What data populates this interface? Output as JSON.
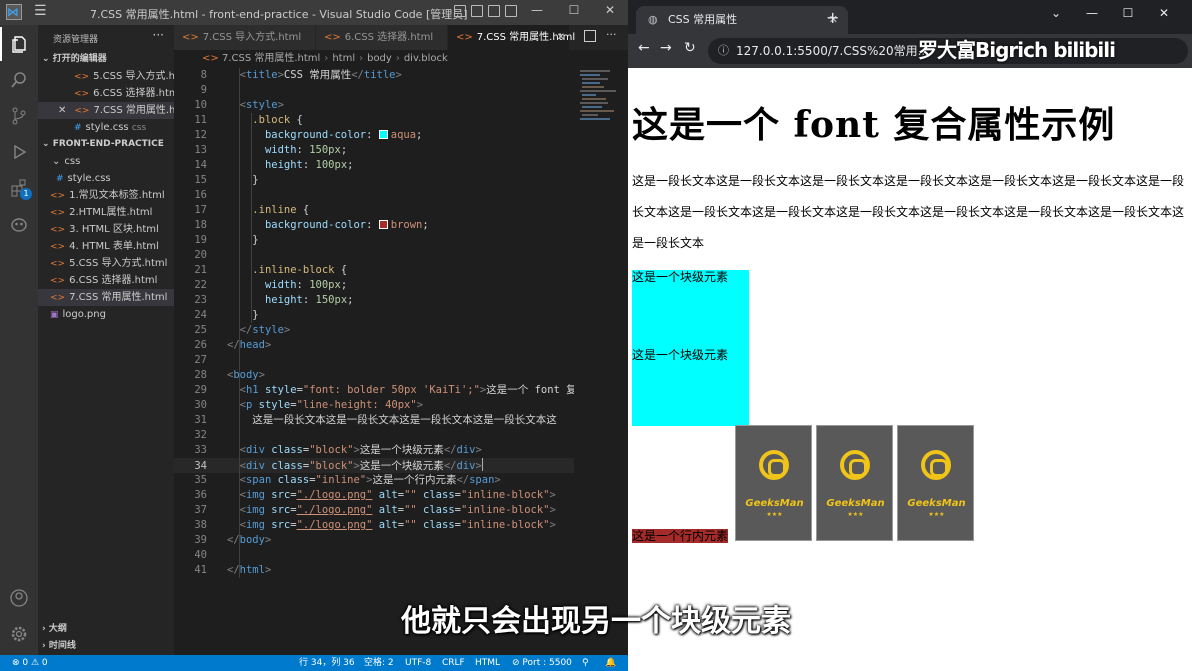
{
  "vscode": {
    "window_title": "7.CSS 常用属性.html - front-end-practice - Visual Studio Code [管理员]",
    "explorer_title": "资源管理器",
    "open_editors_label": "打开的编辑器",
    "open_editors": [
      {
        "name": "5.CSS 导入方式.h...",
        "icon": "html-icon"
      },
      {
        "name": "6.CSS 选择器.html",
        "icon": "html-icon"
      },
      {
        "name": "7.CSS 常用属性.h...",
        "icon": "html-icon",
        "active": true
      },
      {
        "name": "style.css",
        "detail": "css",
        "icon": "css-icon"
      }
    ],
    "project_label": "FRONT-END-PRACTICE",
    "tree": [
      {
        "name": "css",
        "type": "folder"
      },
      {
        "name": "style.css",
        "type": "css"
      },
      {
        "name": "1.常见文本标签.html",
        "type": "html"
      },
      {
        "name": "2.HTML属性.html",
        "type": "html"
      },
      {
        "name": "3. HTML 区块.html",
        "type": "html"
      },
      {
        "name": "4. HTML 表单.html",
        "type": "html"
      },
      {
        "name": "5.CSS 导入方式.html",
        "type": "html"
      },
      {
        "name": "6.CSS 选择器.html",
        "type": "html"
      },
      {
        "name": "7.CSS 常用属性.html",
        "type": "html",
        "selected": true
      },
      {
        "name": "logo.png",
        "type": "image"
      }
    ],
    "outline_label": "大纲",
    "timeline_label": "时间线",
    "tabs": [
      {
        "label": "7.CSS 导入方式.html"
      },
      {
        "label": "6.CSS 选择器.html"
      },
      {
        "label": "7.CSS 常用属性.html",
        "active": true
      }
    ],
    "breadcrumb": [
      "7.CSS 常用属性.html",
      "html",
      "body",
      "div.block"
    ],
    "code": {
      "l8": {
        "n": "8",
        "a": "<",
        "b": "title",
        "c": ">",
        "d": "CSS 常用属性",
        "e": "</",
        "f": "title",
        "g": ">"
      },
      "l10": {
        "n": "10",
        "a": "<",
        "b": "style",
        "c": ">"
      },
      "l11": {
        "n": "11",
        "a": ".block",
        "b": " {"
      },
      "l12": {
        "n": "12",
        "a": "background-color",
        "b": ": ",
        "c": "aqua",
        "d": ";"
      },
      "l13": {
        "n": "13",
        "a": "width",
        "b": ": ",
        "c": "150px",
        "d": ";"
      },
      "l14": {
        "n": "14",
        "a": "height",
        "b": ": ",
        "c": "100px",
        "d": ";"
      },
      "l15": {
        "n": "15",
        "a": "}"
      },
      "l17": {
        "n": "17",
        "a": ".inline",
        "b": " {"
      },
      "l18": {
        "n": "18",
        "a": "background-color",
        "b": ": ",
        "c": "brown",
        "d": ";"
      },
      "l19": {
        "n": "19",
        "a": "}"
      },
      "l21": {
        "n": "21",
        "a": ".inline-block",
        "b": " {"
      },
      "l22": {
        "n": "22",
        "a": "width",
        "b": ": ",
        "c": "100px",
        "d": ";"
      },
      "l23": {
        "n": "23",
        "a": "height",
        "b": ": ",
        "c": "150px",
        "d": ";"
      },
      "l24": {
        "n": "24",
        "a": "}"
      },
      "l25": {
        "n": "25",
        "a": "</",
        "b": "style",
        "c": ">"
      },
      "l26": {
        "n": "26",
        "a": "</",
        "b": "head",
        "c": ">"
      },
      "l28": {
        "n": "28",
        "a": "<",
        "b": "body",
        "c": ">"
      },
      "l29": {
        "n": "29",
        "a": "<",
        "b": "h1",
        "c": " style",
        "d": "=",
        "e": "\"font: bolder 50px 'KaiTi';\"",
        "f": ">",
        "g": "这是一个 font 复合"
      },
      "l30": {
        "n": "30",
        "a": "<",
        "b": "p",
        "c": " style",
        "d": "=",
        "e": "\"line-height: 40px\"",
        "f": ">"
      },
      "l31": {
        "n": "31",
        "a": "这是一段长文本这是一段长文本这是一段长文本这是一段长文本这"
      },
      "l33": {
        "n": "33",
        "a": "<",
        "b": "div",
        "c": " class",
        "d": "=",
        "e": "\"block\"",
        "f": ">",
        "g": "这是一个块级元素",
        "h": "</",
        "i": "div",
        "j": ">"
      },
      "l34": {
        "n": "34",
        "a": "<",
        "b": "div",
        "c": " class",
        "d": "=",
        "e": "\"block\"",
        "f": ">",
        "g": "这是一个块级元素",
        "h": "</",
        "i": "div",
        "j": ">"
      },
      "l35": {
        "n": "35",
        "a": "<",
        "b": "span",
        "c": " class",
        "d": "=",
        "e": "\"inline\"",
        "f": ">",
        "g": "这是一个行内元素",
        "h": "</",
        "i": "span",
        "j": ">"
      },
      "l36": {
        "n": "36",
        "a": "<",
        "b": "img",
        "c": " src",
        "d": "=",
        "e": "\"./logo.png\"",
        "f": " alt",
        "g": "=",
        "h": "\"\"",
        "i": " class",
        "j": "=",
        "k": "\"inline-block\"",
        "l": ">"
      },
      "l37": {
        "n": "37",
        "a": "<",
        "b": "img",
        "c": " src",
        "d": "=",
        "e": "\"./logo.png\"",
        "f": " alt",
        "g": "=",
        "h": "\"\"",
        "i": " class",
        "j": "=",
        "k": "\"inline-block\"",
        "l": ">"
      },
      "l38": {
        "n": "38",
        "a": "<",
        "b": "img",
        "c": " src",
        "d": "=",
        "e": "\"./logo.png\"",
        "f": " alt",
        "g": "=",
        "h": "\"\"",
        "i": " class",
        "j": "=",
        "k": "\"inline-block\"",
        "l": ">"
      },
      "l39": {
        "n": "39",
        "a": "</",
        "b": "body",
        "c": ">"
      },
      "l41": {
        "n": "41",
        "a": "</",
        "b": "html",
        "c": ">"
      }
    },
    "blank_lines": [
      "9",
      "16",
      "20",
      "27",
      "32",
      "40"
    ],
    "status": {
      "errors": "⊗ 0 ⚠ 0",
      "position": "行 34，列 36",
      "spaces": "空格: 2",
      "encoding": "UTF-8",
      "eol": "CRLF",
      "language": "HTML",
      "port": "⊘ Port : 5500"
    }
  },
  "browser": {
    "tab_title": "CSS 常用属性",
    "url": "127.0.0.1:5500/7.CSS%20常用...",
    "watermark": "罗大富Bigrich bilibili",
    "page": {
      "h1": "这是一个 font 复合属性示例",
      "paragraph": "这是一段长文本这是一段长文本这是一段长文本这是一段长文本这是一段长文本这是一段长文本这是一段长文本这是一段长文本这是一段长文本这是一段长文本这是一段长文本这是一段长文本这是一段长文本这是一段长文本",
      "block1": "这是一个块级元素",
      "block2": "这是一个块级元素",
      "inline": "这是一个行内元素",
      "logo_text": "GeeksMan",
      "logo_stars": "★★★"
    }
  },
  "subtitle": "他就只会出现另一个块级元素",
  "colors": {
    "accent": "#007acc",
    "aqua": "#00ffff",
    "brown": "#a52a2a"
  }
}
